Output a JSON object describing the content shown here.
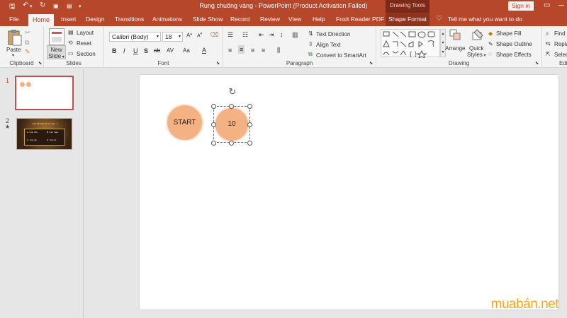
{
  "window": {
    "title": "Rung chuông vàng  -  PowerPoint (Product Activation Failed)",
    "context_group": "Drawing Tools",
    "sign_in": "Sign in"
  },
  "tabs": [
    "File",
    "Home",
    "Insert",
    "Design",
    "Transitions",
    "Animations",
    "Slide Show",
    "Record",
    "Review",
    "View",
    "Help",
    "Foxit Reader PDF",
    "Shape Format"
  ],
  "tell_me": "Tell me what you want to do",
  "ribbon": {
    "clipboard": {
      "paste": "Paste",
      "group": "Clipboard"
    },
    "slides": {
      "new_slide": "New",
      "new_slide2": "Slide",
      "layout": "Layout",
      "reset": "Reset",
      "section": "Section",
      "group": "Slides"
    },
    "font": {
      "name": "Calibri (Body)",
      "size": "18",
      "group": "Font",
      "buttons": [
        "B",
        "I",
        "U",
        "S",
        "ab",
        "AV",
        "Aa",
        "A"
      ]
    },
    "paragraph": {
      "text_direction": "Text Direction",
      "align_text": "Align Text",
      "convert": "Convert to SmartArt",
      "group": "Paragraph"
    },
    "drawing": {
      "arrange": "Arrange",
      "quick": "Quick",
      "styles": "Styles",
      "shape_fill": "Shape Fill",
      "shape_outline": "Shape Outline",
      "shape_effects": "Shape Effects",
      "group": "Drawing"
    },
    "editing": {
      "find": "Find",
      "replace": "Replace",
      "select": "Select",
      "group": "Editing"
    }
  },
  "thumbnails": [
    {
      "number": "1",
      "star": ""
    },
    {
      "number": "2",
      "star": "★"
    }
  ],
  "thumb2": {
    "title": "Câu hỏi: Đâu là con vật ...?",
    "options": [
      "A. Con chó",
      "B. Con mèo",
      "C. Con gà",
      "D. Con vịt"
    ]
  },
  "slide": {
    "start_label": "START",
    "number_label": "10"
  },
  "colors": {
    "accent": "#b7472a",
    "shape_fill": "#f4b183"
  },
  "watermark": {
    "brand": "muabán",
    "tld": ".net"
  }
}
